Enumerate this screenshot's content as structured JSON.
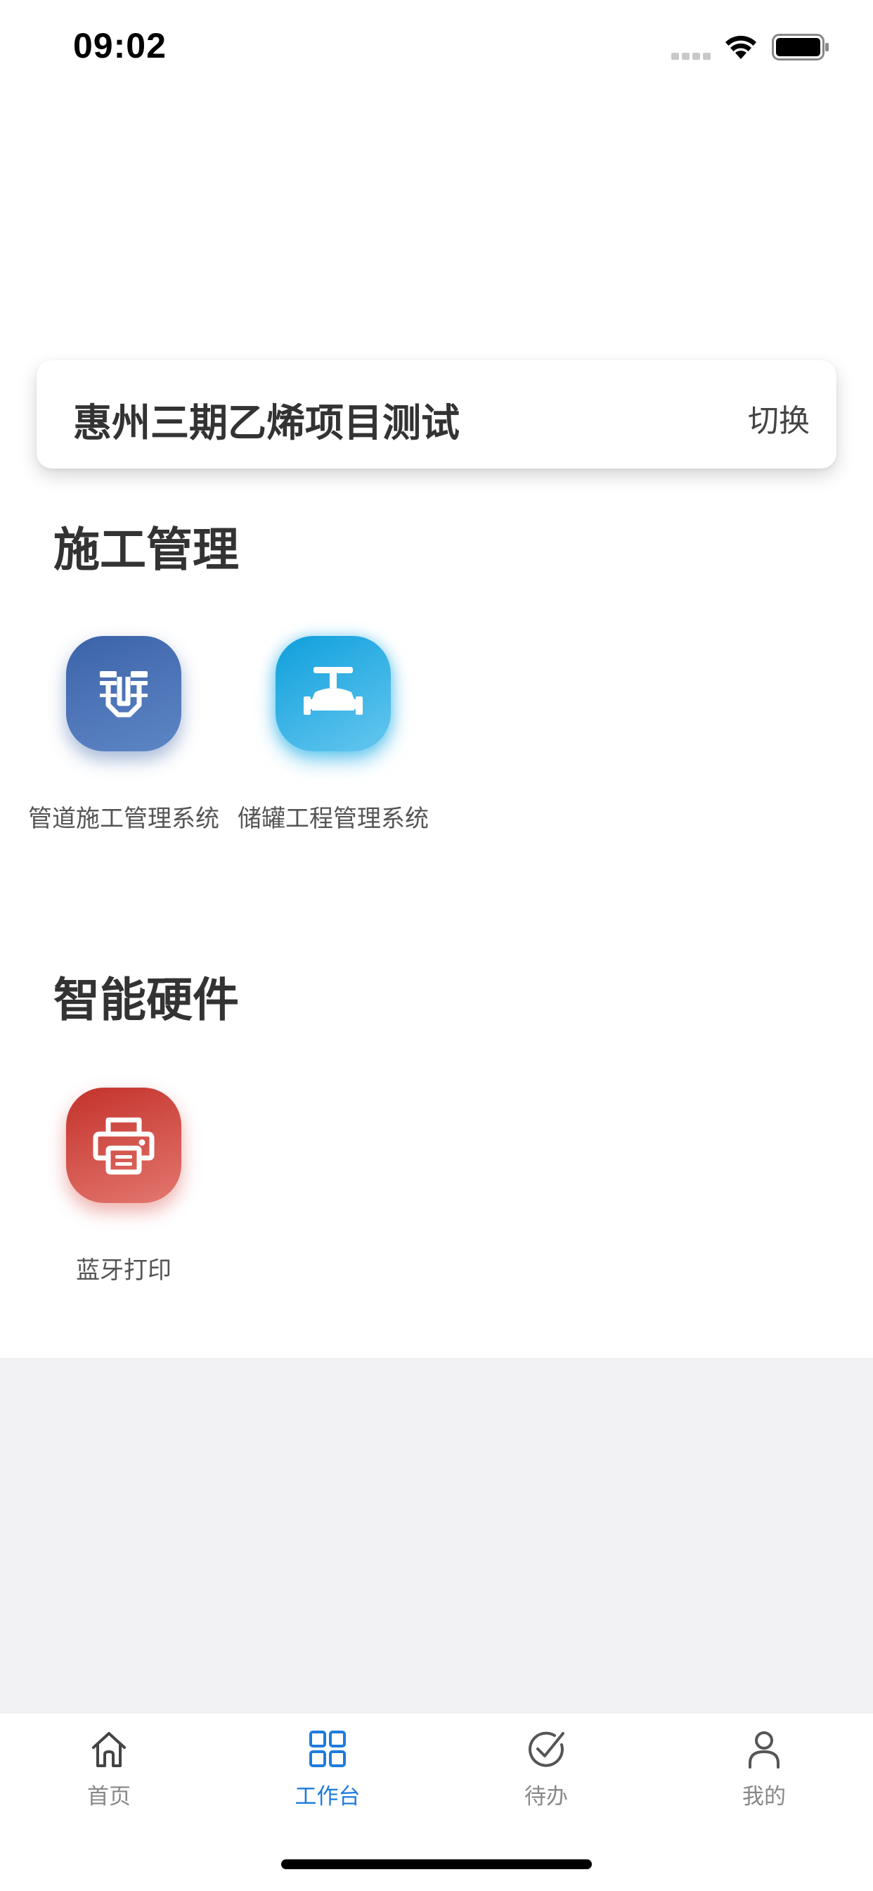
{
  "status_bar": {
    "time": "09:02"
  },
  "project": {
    "name": "惠州三期乙烯项目测试",
    "switch_label": "切换"
  },
  "sections": [
    {
      "title": "施工管理",
      "apps": [
        {
          "label": "管道施工管理系统",
          "icon": "pipe-icon",
          "color": "#3c63a8"
        },
        {
          "label": "储罐工程管理系统",
          "icon": "valve-icon",
          "color": "#18a5e4"
        }
      ]
    },
    {
      "title": "智能硬件",
      "apps": [
        {
          "label": "蓝牙打印",
          "icon": "printer-icon",
          "color": "#d0453d"
        }
      ]
    }
  ],
  "tab_bar": {
    "items": [
      {
        "label": "首页",
        "icon": "home-icon",
        "active": false
      },
      {
        "label": "工作台",
        "icon": "grid-icon",
        "active": true
      },
      {
        "label": "待办",
        "icon": "check-circle-icon",
        "active": false
      },
      {
        "label": "我的",
        "icon": "user-icon",
        "active": false
      }
    ],
    "active_color": "#1e7bdc",
    "inactive_color": "#888888"
  }
}
